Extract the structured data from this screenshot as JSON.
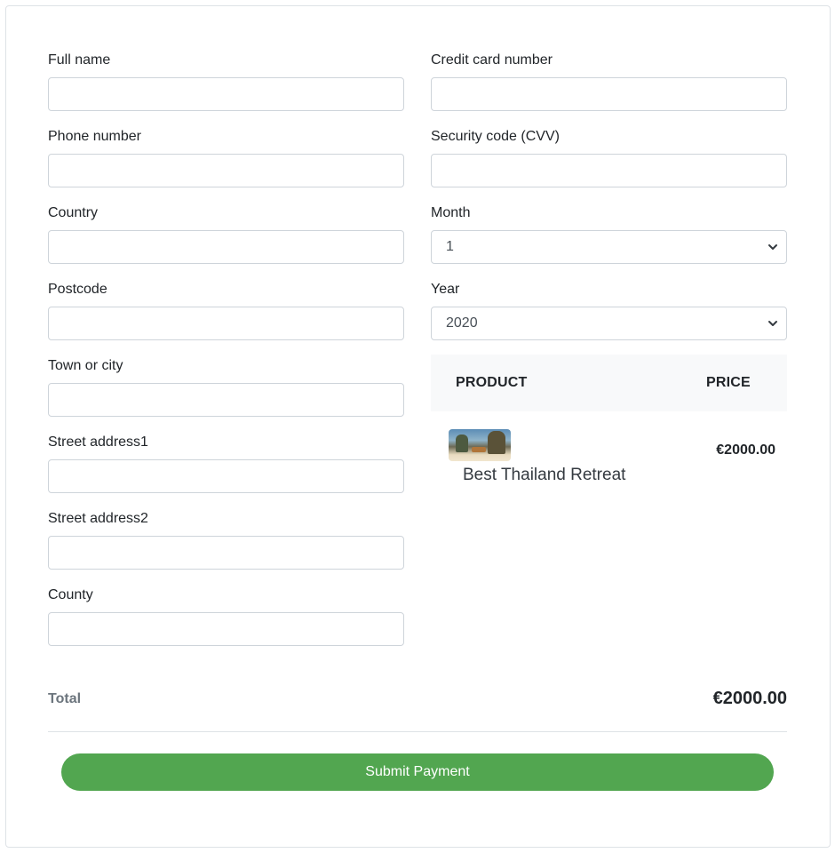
{
  "billing": {
    "full_name": {
      "label": "Full name",
      "value": ""
    },
    "phone": {
      "label": "Phone number",
      "value": ""
    },
    "country": {
      "label": "Country",
      "value": ""
    },
    "postcode": {
      "label": "Postcode",
      "value": ""
    },
    "town": {
      "label": "Town or city",
      "value": ""
    },
    "street1": {
      "label": "Street address1",
      "value": ""
    },
    "street2": {
      "label": "Street address2",
      "value": ""
    },
    "county": {
      "label": "County",
      "value": ""
    }
  },
  "payment": {
    "card_number": {
      "label": "Credit card number",
      "value": ""
    },
    "cvv": {
      "label": "Security code (CVV)",
      "value": ""
    },
    "month": {
      "label": "Month",
      "selected": "1"
    },
    "year": {
      "label": "Year",
      "selected": "2020"
    }
  },
  "order": {
    "header_product": "PRODUCT",
    "header_price": "PRICE",
    "items": [
      {
        "name": "Best Thailand Retreat",
        "price": "€2000.00",
        "thumbnail_icon": "beach-photo"
      }
    ],
    "total_label": "Total",
    "total_value": "€2000.00"
  },
  "submit_label": "Submit Payment",
  "colors": {
    "submit_bg": "#52a650",
    "table_header_bg": "#f8f9fa",
    "border": "#ced4da"
  }
}
